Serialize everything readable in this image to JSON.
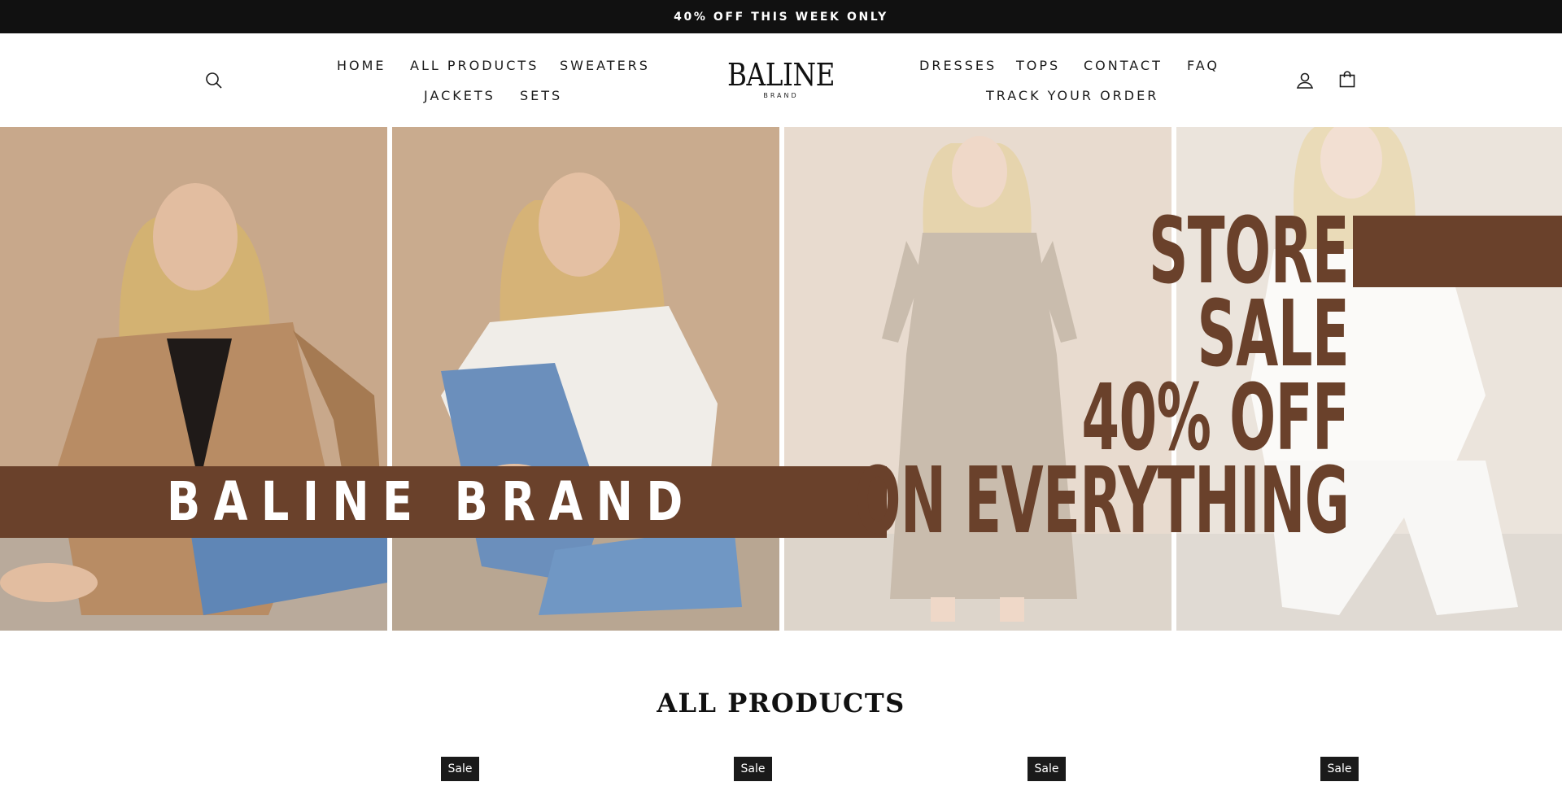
{
  "announcement": "40% OFF THIS WEEK ONLY",
  "header": {
    "logo": {
      "name": "BALINE",
      "sub": "BRAND"
    },
    "nav_left": [
      "HOME",
      "ALL PRODUCTS",
      "SWEATERS",
      "JACKETS",
      "SETS"
    ],
    "nav_right": [
      "DRESSES",
      "TOPS",
      "CONTACT",
      "FAQ",
      "TRACK YOUR ORDER"
    ],
    "icons": {
      "search": "search-icon",
      "account": "user-icon",
      "cart": "bag-icon"
    }
  },
  "hero": {
    "brand_text": "BALINE BRAND",
    "sale_lines": [
      "STORE",
      "SALE",
      "40% OFF",
      "ON EVERYTHING"
    ],
    "accent_color": "#6a412b"
  },
  "section": {
    "title": "ALL PRODUCTS"
  },
  "badges": [
    "Sale",
    "Sale",
    "Sale",
    "Sale"
  ],
  "colors": {
    "announcement_bg": "#111111",
    "badge_bg": "#1a1a1a"
  }
}
